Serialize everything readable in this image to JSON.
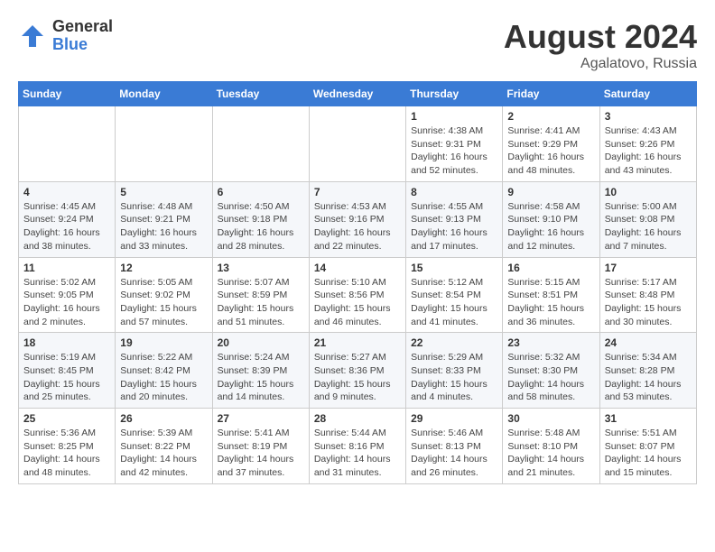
{
  "logo": {
    "general": "General",
    "blue": "Blue"
  },
  "title": {
    "month_year": "August 2024",
    "location": "Agalatovo, Russia"
  },
  "weekdays": [
    "Sunday",
    "Monday",
    "Tuesday",
    "Wednesday",
    "Thursday",
    "Friday",
    "Saturday"
  ],
  "weeks": [
    [
      {
        "day": "",
        "info": ""
      },
      {
        "day": "",
        "info": ""
      },
      {
        "day": "",
        "info": ""
      },
      {
        "day": "",
        "info": ""
      },
      {
        "day": "1",
        "info": "Sunrise: 4:38 AM\nSunset: 9:31 PM\nDaylight: 16 hours\nand 52 minutes."
      },
      {
        "day": "2",
        "info": "Sunrise: 4:41 AM\nSunset: 9:29 PM\nDaylight: 16 hours\nand 48 minutes."
      },
      {
        "day": "3",
        "info": "Sunrise: 4:43 AM\nSunset: 9:26 PM\nDaylight: 16 hours\nand 43 minutes."
      }
    ],
    [
      {
        "day": "4",
        "info": "Sunrise: 4:45 AM\nSunset: 9:24 PM\nDaylight: 16 hours\nand 38 minutes."
      },
      {
        "day": "5",
        "info": "Sunrise: 4:48 AM\nSunset: 9:21 PM\nDaylight: 16 hours\nand 33 minutes."
      },
      {
        "day": "6",
        "info": "Sunrise: 4:50 AM\nSunset: 9:18 PM\nDaylight: 16 hours\nand 28 minutes."
      },
      {
        "day": "7",
        "info": "Sunrise: 4:53 AM\nSunset: 9:16 PM\nDaylight: 16 hours\nand 22 minutes."
      },
      {
        "day": "8",
        "info": "Sunrise: 4:55 AM\nSunset: 9:13 PM\nDaylight: 16 hours\nand 17 minutes."
      },
      {
        "day": "9",
        "info": "Sunrise: 4:58 AM\nSunset: 9:10 PM\nDaylight: 16 hours\nand 12 minutes."
      },
      {
        "day": "10",
        "info": "Sunrise: 5:00 AM\nSunset: 9:08 PM\nDaylight: 16 hours\nand 7 minutes."
      }
    ],
    [
      {
        "day": "11",
        "info": "Sunrise: 5:02 AM\nSunset: 9:05 PM\nDaylight: 16 hours\nand 2 minutes."
      },
      {
        "day": "12",
        "info": "Sunrise: 5:05 AM\nSunset: 9:02 PM\nDaylight: 15 hours\nand 57 minutes."
      },
      {
        "day": "13",
        "info": "Sunrise: 5:07 AM\nSunset: 8:59 PM\nDaylight: 15 hours\nand 51 minutes."
      },
      {
        "day": "14",
        "info": "Sunrise: 5:10 AM\nSunset: 8:56 PM\nDaylight: 15 hours\nand 46 minutes."
      },
      {
        "day": "15",
        "info": "Sunrise: 5:12 AM\nSunset: 8:54 PM\nDaylight: 15 hours\nand 41 minutes."
      },
      {
        "day": "16",
        "info": "Sunrise: 5:15 AM\nSunset: 8:51 PM\nDaylight: 15 hours\nand 36 minutes."
      },
      {
        "day": "17",
        "info": "Sunrise: 5:17 AM\nSunset: 8:48 PM\nDaylight: 15 hours\nand 30 minutes."
      }
    ],
    [
      {
        "day": "18",
        "info": "Sunrise: 5:19 AM\nSunset: 8:45 PM\nDaylight: 15 hours\nand 25 minutes."
      },
      {
        "day": "19",
        "info": "Sunrise: 5:22 AM\nSunset: 8:42 PM\nDaylight: 15 hours\nand 20 minutes."
      },
      {
        "day": "20",
        "info": "Sunrise: 5:24 AM\nSunset: 8:39 PM\nDaylight: 15 hours\nand 14 minutes."
      },
      {
        "day": "21",
        "info": "Sunrise: 5:27 AM\nSunset: 8:36 PM\nDaylight: 15 hours\nand 9 minutes."
      },
      {
        "day": "22",
        "info": "Sunrise: 5:29 AM\nSunset: 8:33 PM\nDaylight: 15 hours\nand 4 minutes."
      },
      {
        "day": "23",
        "info": "Sunrise: 5:32 AM\nSunset: 8:30 PM\nDaylight: 14 hours\nand 58 minutes."
      },
      {
        "day": "24",
        "info": "Sunrise: 5:34 AM\nSunset: 8:28 PM\nDaylight: 14 hours\nand 53 minutes."
      }
    ],
    [
      {
        "day": "25",
        "info": "Sunrise: 5:36 AM\nSunset: 8:25 PM\nDaylight: 14 hours\nand 48 minutes."
      },
      {
        "day": "26",
        "info": "Sunrise: 5:39 AM\nSunset: 8:22 PM\nDaylight: 14 hours\nand 42 minutes."
      },
      {
        "day": "27",
        "info": "Sunrise: 5:41 AM\nSunset: 8:19 PM\nDaylight: 14 hours\nand 37 minutes."
      },
      {
        "day": "28",
        "info": "Sunrise: 5:44 AM\nSunset: 8:16 PM\nDaylight: 14 hours\nand 31 minutes."
      },
      {
        "day": "29",
        "info": "Sunrise: 5:46 AM\nSunset: 8:13 PM\nDaylight: 14 hours\nand 26 minutes."
      },
      {
        "day": "30",
        "info": "Sunrise: 5:48 AM\nSunset: 8:10 PM\nDaylight: 14 hours\nand 21 minutes."
      },
      {
        "day": "31",
        "info": "Sunrise: 5:51 AM\nSunset: 8:07 PM\nDaylight: 14 hours\nand 15 minutes."
      }
    ]
  ]
}
